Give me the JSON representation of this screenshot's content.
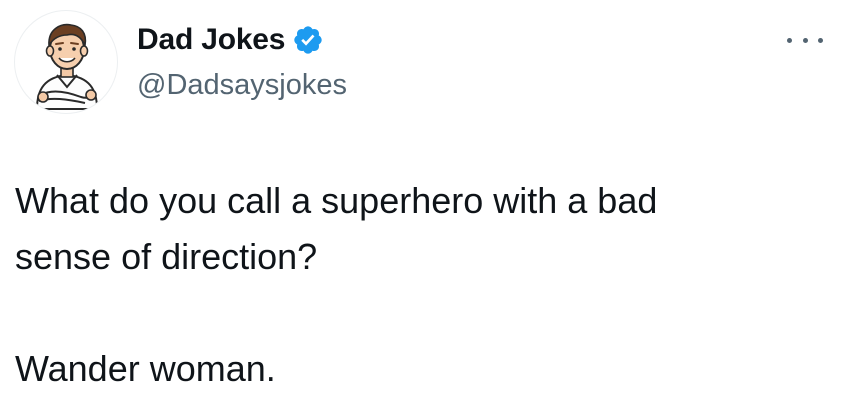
{
  "account": {
    "display_name": "Dad Jokes",
    "handle": "@Dadsaysjokes",
    "verified": true,
    "avatar_icon": "cartoon-man-avatar",
    "verified_icon": "verified-badge-icon",
    "verified_color": "#1d9bf0"
  },
  "menu": {
    "icon": "more-options-icon"
  },
  "tweet": {
    "setup_line_1": "What do you call a superhero with a bad",
    "setup_line_2": "sense of direction?",
    "punchline": "Wander woman."
  },
  "colors": {
    "text": "#0f1419",
    "secondary_text": "#536471",
    "background": "#ffffff"
  }
}
